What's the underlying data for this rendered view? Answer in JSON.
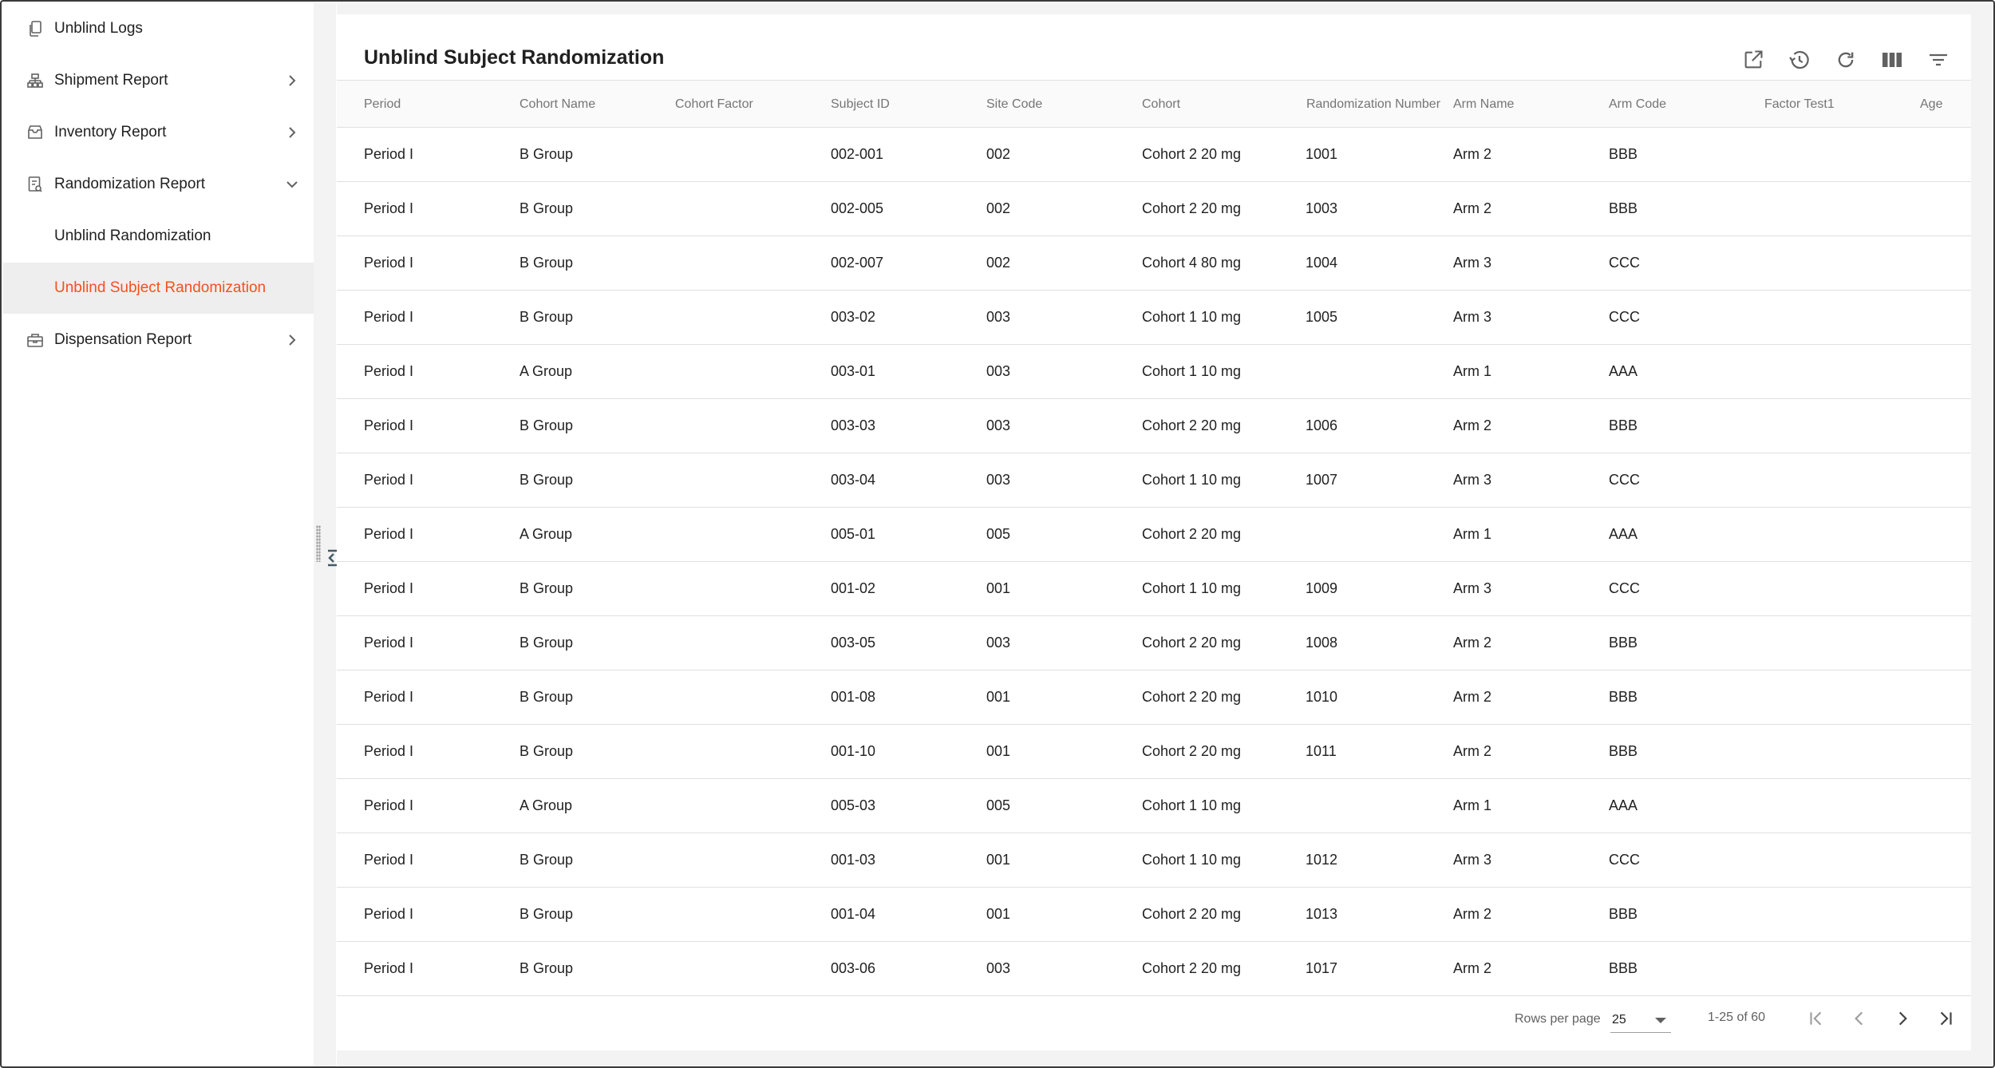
{
  "sidebar": {
    "items": [
      {
        "label": "Unblind Logs",
        "icon": "documents-icon"
      },
      {
        "label": "Shipment Report",
        "icon": "shipment-icon",
        "chevron": "right"
      },
      {
        "label": "Inventory Report",
        "icon": "inventory-icon",
        "chevron": "right"
      },
      {
        "label": "Randomization Report",
        "icon": "report-icon",
        "chevron": "down"
      },
      {
        "label": "Dispensation Report",
        "icon": "dispensation-icon",
        "chevron": "right"
      }
    ],
    "sub_items": [
      {
        "label": "Unblind Randomization",
        "active": false
      },
      {
        "label": "Unblind Subject Randomization",
        "active": true
      }
    ]
  },
  "page": {
    "title": "Unblind Subject Randomization"
  },
  "toolbar": {
    "icons": [
      "open-external-icon",
      "history-icon",
      "refresh-icon",
      "columns-icon",
      "filter-icon"
    ]
  },
  "table": {
    "columns": [
      "Period",
      "Cohort Name",
      "Cohort Factor",
      "Subject ID",
      "Site Code",
      "Cohort",
      "Randomization Number",
      "Arm Name",
      "Arm Code",
      "Factor Test1",
      "Age"
    ],
    "rows": [
      [
        "Period I",
        "B Group",
        "",
        "002-001",
        "002",
        "Cohort 2 20 mg",
        "1001",
        "Arm 2",
        "BBB",
        "",
        ""
      ],
      [
        "Period I",
        "B Group",
        "",
        "002-005",
        "002",
        "Cohort 2 20 mg",
        "1003",
        "Arm 2",
        "BBB",
        "",
        ""
      ],
      [
        "Period I",
        "B Group",
        "",
        "002-007",
        "002",
        "Cohort 4 80 mg",
        "1004",
        "Arm 3",
        "CCC",
        "",
        ""
      ],
      [
        "Period I",
        "B Group",
        "",
        "003-02",
        "003",
        "Cohort 1 10 mg",
        "1005",
        "Arm 3",
        "CCC",
        "",
        ""
      ],
      [
        "Period I",
        "A Group",
        "",
        "003-01",
        "003",
        "Cohort 1 10 mg",
        "",
        "Arm 1",
        "AAA",
        "",
        ""
      ],
      [
        "Period I",
        "B Group",
        "",
        "003-03",
        "003",
        "Cohort 2 20 mg",
        "1006",
        "Arm 2",
        "BBB",
        "",
        ""
      ],
      [
        "Period I",
        "B Group",
        "",
        "003-04",
        "003",
        "Cohort 1 10 mg",
        "1007",
        "Arm 3",
        "CCC",
        "",
        ""
      ],
      [
        "Period I",
        "A Group",
        "",
        "005-01",
        "005",
        "Cohort 2 20 mg",
        "",
        "Arm 1",
        "AAA",
        "",
        ""
      ],
      [
        "Period I",
        "B Group",
        "",
        "001-02",
        "001",
        "Cohort 1 10 mg",
        "1009",
        "Arm 3",
        "CCC",
        "",
        ""
      ],
      [
        "Period I",
        "B Group",
        "",
        "003-05",
        "003",
        "Cohort 2 20 mg",
        "1008",
        "Arm 2",
        "BBB",
        "",
        ""
      ],
      [
        "Period I",
        "B Group",
        "",
        "001-08",
        "001",
        "Cohort 2 20 mg",
        "1010",
        "Arm 2",
        "BBB",
        "",
        ""
      ],
      [
        "Period I",
        "B Group",
        "",
        "001-10",
        "001",
        "Cohort 2 20 mg",
        "1011",
        "Arm 2",
        "BBB",
        "",
        ""
      ],
      [
        "Period I",
        "A Group",
        "",
        "005-03",
        "005",
        "Cohort 1 10 mg",
        "",
        "Arm 1",
        "AAA",
        "",
        ""
      ],
      [
        "Period I",
        "B Group",
        "",
        "001-03",
        "001",
        "Cohort 1 10 mg",
        "1012",
        "Arm 3",
        "CCC",
        "",
        ""
      ],
      [
        "Period I",
        "B Group",
        "",
        "001-04",
        "001",
        "Cohort 2 20 mg",
        "1013",
        "Arm 2",
        "BBB",
        "",
        ""
      ],
      [
        "Period I",
        "B Group",
        "",
        "003-06",
        "003",
        "Cohort 2 20 mg",
        "1017",
        "Arm 2",
        "BBB",
        "",
        ""
      ]
    ]
  },
  "pagination": {
    "rows_per_page_label": "Rows per page",
    "rows_per_page_value": "25",
    "range_text": "1-25 of 60"
  },
  "colors": {
    "accent": "#f4511e",
    "text": "#212121",
    "muted": "#757575",
    "divider": "#e0e0e0"
  }
}
